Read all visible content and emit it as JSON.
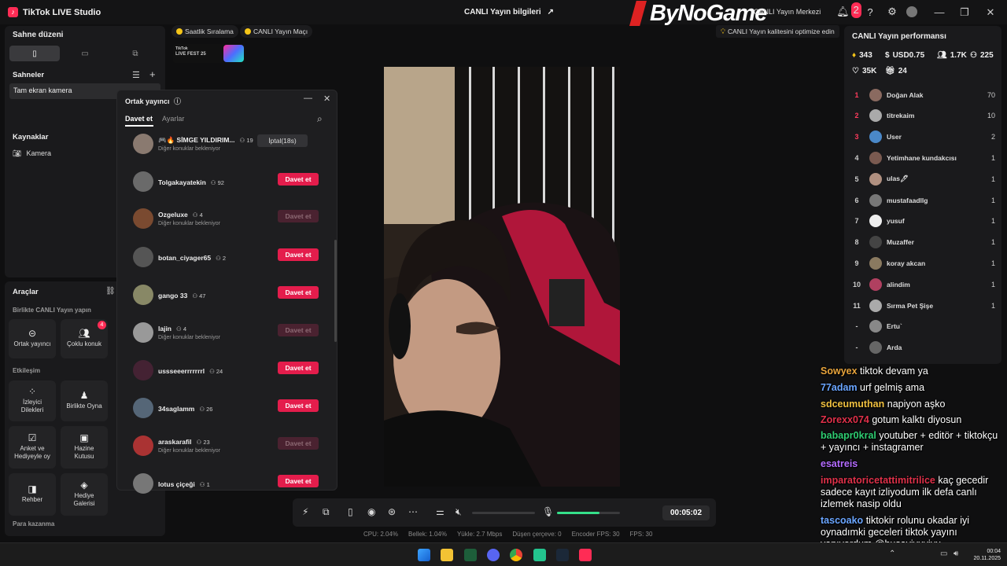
{
  "titlebar": {
    "app_name": "TikTok LIVE Studio",
    "center_title": "CANLI Yayın bilgileri",
    "watermark": "ByNoGame",
    "live_center": "CANLI Yayın Merkezi",
    "notification_count": "2"
  },
  "scenes": {
    "layout_title": "Sahne düzeni",
    "scenes_title": "Sahneler",
    "scene_item": "Tam ekran kamera",
    "sources_title": "Kaynaklar",
    "source_item": "Kamera"
  },
  "tools": {
    "title": "Araçlar",
    "section_live_together": "Birlikte CANLI Yayın yapın",
    "co_host": "Ortak yayıncı",
    "multi_guest": "Çoklu konuk",
    "multi_guest_badge": "4",
    "section_interaction": "Etkileşim",
    "viewer_requests": "İzleyici Dilekleri",
    "play_together": "Birlikte Oyna",
    "poll_gift": "Anket ve Hediyeyle oy",
    "treasure_box": "Hazine Kutusu",
    "guide": "Rehber",
    "gift_gallery": "Hediye Galerisi",
    "section_earn": "Para kazanma"
  },
  "top_chips": {
    "hourly_ranking": "Saatlik Sıralama",
    "live_match": "CANLI Yayın Maçı",
    "live_fest_line1": "TikTok",
    "live_fest_line2": "LIVE FEST 25",
    "quality_tip": "CANLI Yayın kalitesini optimize edin"
  },
  "popup": {
    "title": "Ortak yayıncı",
    "tab_invite": "Davet et",
    "tab_settings": "Ayarlar",
    "rows": [
      {
        "name": "🎮🔥 SİMGE YILDIRIM...",
        "count": "19",
        "sub": "Diğer konuklar bekleniyor",
        "action": "İptal(18s)",
        "state": "cancel"
      },
      {
        "name": "Tolgakayatekin",
        "count": "92",
        "sub": "",
        "action": "Davet et",
        "state": "active"
      },
      {
        "name": "Ozgeluxe",
        "count": "4",
        "sub": "Diğer konuklar bekleniyor",
        "action": "Davet et",
        "state": "disabled"
      },
      {
        "name": "botan_ciyager65",
        "count": "2",
        "sub": "",
        "action": "Davet et",
        "state": "active"
      },
      {
        "name": "gango 33",
        "count": "47",
        "sub": "",
        "action": "Davet et",
        "state": "active"
      },
      {
        "name": "lajin",
        "count": "4",
        "sub": "Diğer konuklar bekleniyor",
        "action": "Davet et",
        "state": "disabled"
      },
      {
        "name": "usssееerrrrrrrl",
        "count": "24",
        "sub": "",
        "action": "Davet et",
        "state": "active"
      },
      {
        "name": "34saglamm",
        "count": "26",
        "sub": "",
        "action": "Davet et",
        "state": "active"
      },
      {
        "name": "araskarafil",
        "count": "23",
        "sub": "Diğer konuklar bekleniyor",
        "action": "Davet et",
        "state": "disabled"
      },
      {
        "name": "lotus çiçeği",
        "count": "1",
        "sub": "",
        "action": "Davet et",
        "state": "active"
      }
    ]
  },
  "performance": {
    "title": "CANLI Yayın performansı",
    "diamonds": "343",
    "usd": "USD0.75",
    "viewers": "1.7K",
    "followers": "225",
    "likes": "35K",
    "gifts": "24",
    "ranking": [
      {
        "rank": "1",
        "name": "Doğan Alak",
        "score": "70"
      },
      {
        "rank": "2",
        "name": "titrekaim",
        "score": "10"
      },
      {
        "rank": "3",
        "name": "User",
        "score": "2"
      },
      {
        "rank": "4",
        "name": "Yetimhane kundakcısı",
        "score": "1"
      },
      {
        "rank": "5",
        "name": "ulas🖊",
        "score": "1"
      },
      {
        "rank": "6",
        "name": "mustafaadllg",
        "score": "1"
      },
      {
        "rank": "7",
        "name": "yusuf",
        "score": "1"
      },
      {
        "rank": "8",
        "name": "Muzaffer",
        "score": "1"
      },
      {
        "rank": "9",
        "name": "koray akcan",
        "score": "1"
      },
      {
        "rank": "10",
        "name": "alindim",
        "score": "1"
      },
      {
        "rank": "11",
        "name": "Sırma Pet Şişe",
        "score": "1"
      },
      {
        "rank": "-",
        "name": "Ertu`",
        "score": ""
      },
      {
        "rank": "-",
        "name": "Arda",
        "score": ""
      }
    ]
  },
  "chat": [
    {
      "user": "Sowyex",
      "msg": "tiktok devam ya",
      "color": "#e8a43c"
    },
    {
      "user": "77adam",
      "msg": "urf gelmiş ama",
      "color": "#6aa5ff"
    },
    {
      "user": "sdceumuthan",
      "msg": "napiyon aşko",
      "color": "#f0c040"
    },
    {
      "user": "Zorexx074",
      "msg": "gotum kalktı diyosun",
      "color": "#e0314a"
    },
    {
      "user": "babapr0kral",
      "msg": "youtuber + editör + tiktokçu + yayıncı + instagramer",
      "color": "#2ecc71"
    },
    {
      "user": "esatreis",
      "msg": "",
      "color": "#b46cff"
    },
    {
      "user": "imparatoricetattimitrilice",
      "msg": "kaç gecedir sadece kayıt izliyodum ilk defa canlı izlemek nasip oldu",
      "color": "#e0314a"
    },
    {
      "user": "tascoako",
      "msg": "tiktokir rolunu okadar iyi oynadımki geceleri tiktok yayını yapıyordum @husaviyuviyu",
      "color": "#6aa5ff"
    }
  ],
  "controls": {
    "timer": "00:05:02",
    "stats": [
      "CPU: 2.04%",
      "Bellek: 1.04%",
      "Yükle: 2.7 Mbps",
      "Düşen çerçeve: 0",
      "Encoder FPS: 30",
      "FPS: 30"
    ],
    "mic_level": 0.68
  },
  "taskbar": {
    "time": "00:04",
    "date": "20.11.2025"
  }
}
